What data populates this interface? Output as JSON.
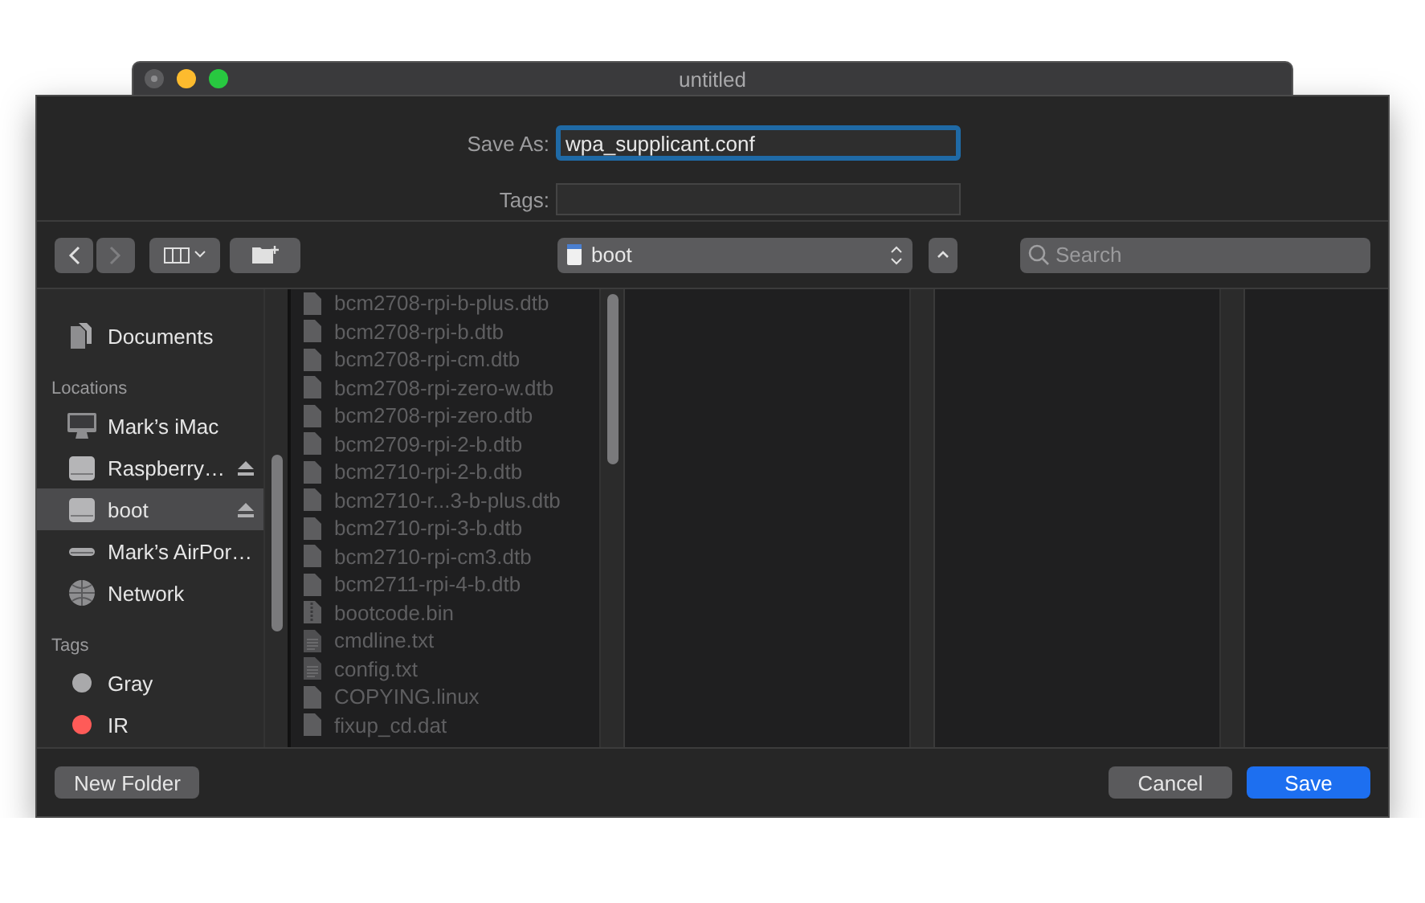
{
  "window": {
    "title": "untitled"
  },
  "save_as": {
    "label": "Save As:",
    "value": "wpa_supplicant.conf",
    "focused": true
  },
  "tags_field": {
    "label": "Tags:"
  },
  "toolbar": {
    "back": {
      "disabled": false
    },
    "forward": {
      "disabled": true
    },
    "location": "boot",
    "search": {
      "placeholder": "Search"
    }
  },
  "sidebar": {
    "sections": [
      {
        "items": [
          {
            "label": "Documents",
            "kind": "documents",
            "selected": false,
            "ejectable": false
          }
        ]
      },
      {
        "title": "Locations",
        "items": [
          {
            "label": "Mark’s iMac",
            "kind": "computer",
            "selected": false,
            "ejectable": false
          },
          {
            "label": "Raspberry…",
            "kind": "drive",
            "selected": false,
            "ejectable": true
          },
          {
            "label": "boot",
            "kind": "drive",
            "selected": true,
            "ejectable": true
          },
          {
            "label": "Mark’s AirPor…",
            "kind": "airport",
            "selected": false,
            "ejectable": false
          },
          {
            "label": "Network",
            "kind": "network",
            "selected": false,
            "ejectable": false
          }
        ]
      },
      {
        "title": "Tags",
        "items": [
          {
            "label": "Gray",
            "kind": "tag",
            "color": "#a9a9ab",
            "selected": false,
            "ejectable": false
          },
          {
            "label": "IR",
            "kind": "tag",
            "color": "#fe5b58",
            "selected": false,
            "ejectable": false
          }
        ]
      }
    ]
  },
  "files": [
    {
      "name": "bcm2708-rpi-b-plus.dtb",
      "kind": "document",
      "disabled": true
    },
    {
      "name": "bcm2708-rpi-b.dtb",
      "kind": "document",
      "disabled": true
    },
    {
      "name": "bcm2708-rpi-cm.dtb",
      "kind": "document",
      "disabled": true
    },
    {
      "name": "bcm2708-rpi-zero-w.dtb",
      "kind": "document",
      "disabled": true
    },
    {
      "name": "bcm2708-rpi-zero.dtb",
      "kind": "document",
      "disabled": true
    },
    {
      "name": "bcm2709-rpi-2-b.dtb",
      "kind": "document",
      "disabled": true
    },
    {
      "name": "bcm2710-rpi-2-b.dtb",
      "kind": "document",
      "disabled": true
    },
    {
      "name": "bcm2710-r...3-b-plus.dtb",
      "kind": "document",
      "disabled": true
    },
    {
      "name": "bcm2710-rpi-3-b.dtb",
      "kind": "document",
      "disabled": true
    },
    {
      "name": "bcm2710-rpi-cm3.dtb",
      "kind": "document",
      "disabled": true
    },
    {
      "name": "bcm2711-rpi-4-b.dtb",
      "kind": "document",
      "disabled": true
    },
    {
      "name": "bootcode.bin",
      "kind": "binary",
      "disabled": true
    },
    {
      "name": "cmdline.txt",
      "kind": "text",
      "disabled": true
    },
    {
      "name": "config.txt",
      "kind": "text",
      "disabled": true
    },
    {
      "name": "COPYING.linux",
      "kind": "document",
      "disabled": true
    },
    {
      "name": "fixup_cd.dat",
      "kind": "document",
      "disabled": true
    }
  ],
  "buttons": {
    "new_folder": "New Folder",
    "cancel": "Cancel",
    "save": "Save"
  }
}
